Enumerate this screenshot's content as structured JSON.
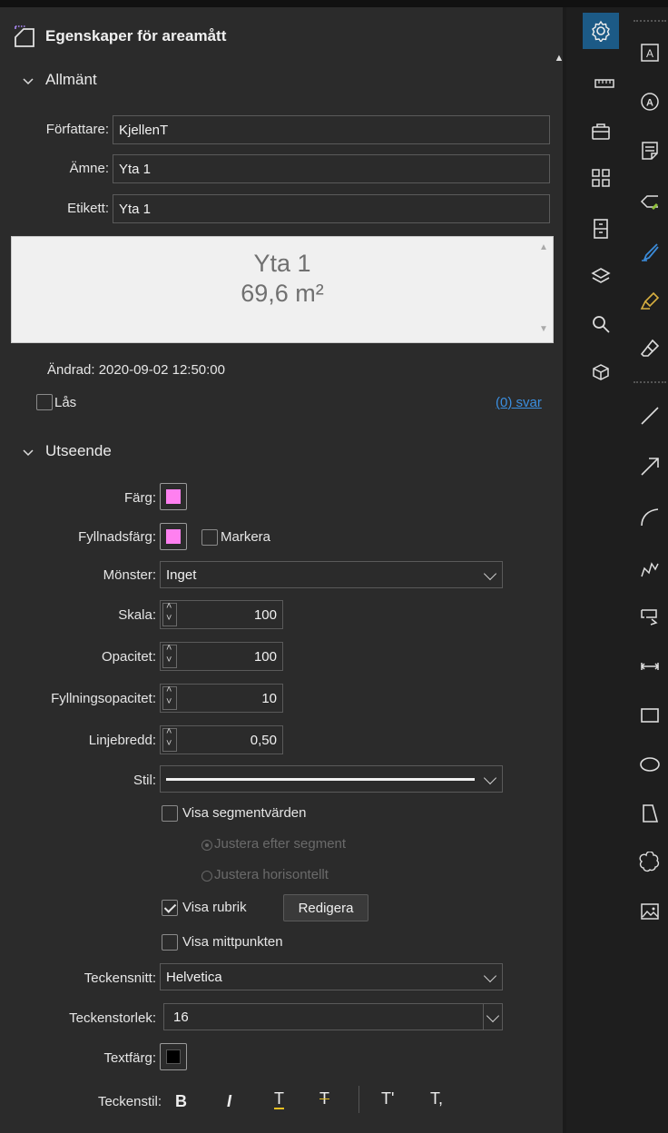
{
  "title": "Egenskaper för areamått",
  "sections": {
    "general": "Allmänt",
    "appearance": "Utseende"
  },
  "general": {
    "author_label": "Författare:",
    "author_value": "KjellenT",
    "subject_label": "Ämne:",
    "subject_value": "Yta 1",
    "label_label": "Etikett:",
    "label_value": "Yta 1",
    "preview_line1": "Yta 1",
    "preview_line2": "69,6 m²",
    "modified": "Ändrad: 2020-09-02 12:50:00",
    "lock_label": "Lås",
    "lock_checked": false,
    "replies_link": "(0) svar"
  },
  "appearance": {
    "color_label": "Färg:",
    "color": "#ff80f0",
    "fill_color_label": "Fyllnadsfärg:",
    "fill_color": "#ff80f0",
    "highlight_label": "Markera",
    "highlight_checked": false,
    "pattern_label": "Mönster:",
    "pattern_value": "Inget",
    "scale_label": "Skala:",
    "scale_value": "100",
    "opacity_label": "Opacitet:",
    "opacity_value": "100",
    "fill_opacity_label": "Fyllningsopacitet:",
    "fill_opacity_value": "10",
    "line_width_label": "Linjebredd:",
    "line_width_value": "0,50",
    "style_label": "Stil:",
    "show_segments_label": "Visa segmentvärden",
    "show_segments_checked": false,
    "align_segment_label": "Justera efter segment",
    "align_horizontal_label": "Justera horisontellt",
    "show_title_label": "Visa rubrik",
    "show_title_checked": true,
    "edit_button": "Redigera",
    "show_midpoint_label": "Visa mittpunkten",
    "show_midpoint_checked": false,
    "font_label": "Teckensnitt:",
    "font_value": "Helvetica",
    "font_size_label": "Teckenstorlek:",
    "font_size_value": "16",
    "text_color_label": "Textfärg:",
    "text_color": "#000000",
    "font_style_label": "Teckenstil:",
    "font_style_buttons": [
      "B",
      "I",
      "T",
      "T",
      "T'",
      "T,"
    ]
  },
  "left_toolbar": [
    "settings-icon",
    "ruler-icon",
    "briefcase-icon",
    "grid-icon",
    "cabinet-icon",
    "layers-icon",
    "search-icon",
    "stamp-icon"
  ],
  "right_toolbar": [
    "text-box-icon",
    "circle-text-icon",
    "note-icon",
    "tag-icon",
    "pen-icon",
    "highlighter-icon",
    "eraser-icon",
    "line-icon",
    "arrow-icon",
    "arc-icon",
    "polyline-icon",
    "callout-icon",
    "dimension-icon",
    "rectangle-icon",
    "ellipse-icon",
    "polygon-icon",
    "cloud-icon",
    "image-icon"
  ],
  "accent": "#1c5a86"
}
